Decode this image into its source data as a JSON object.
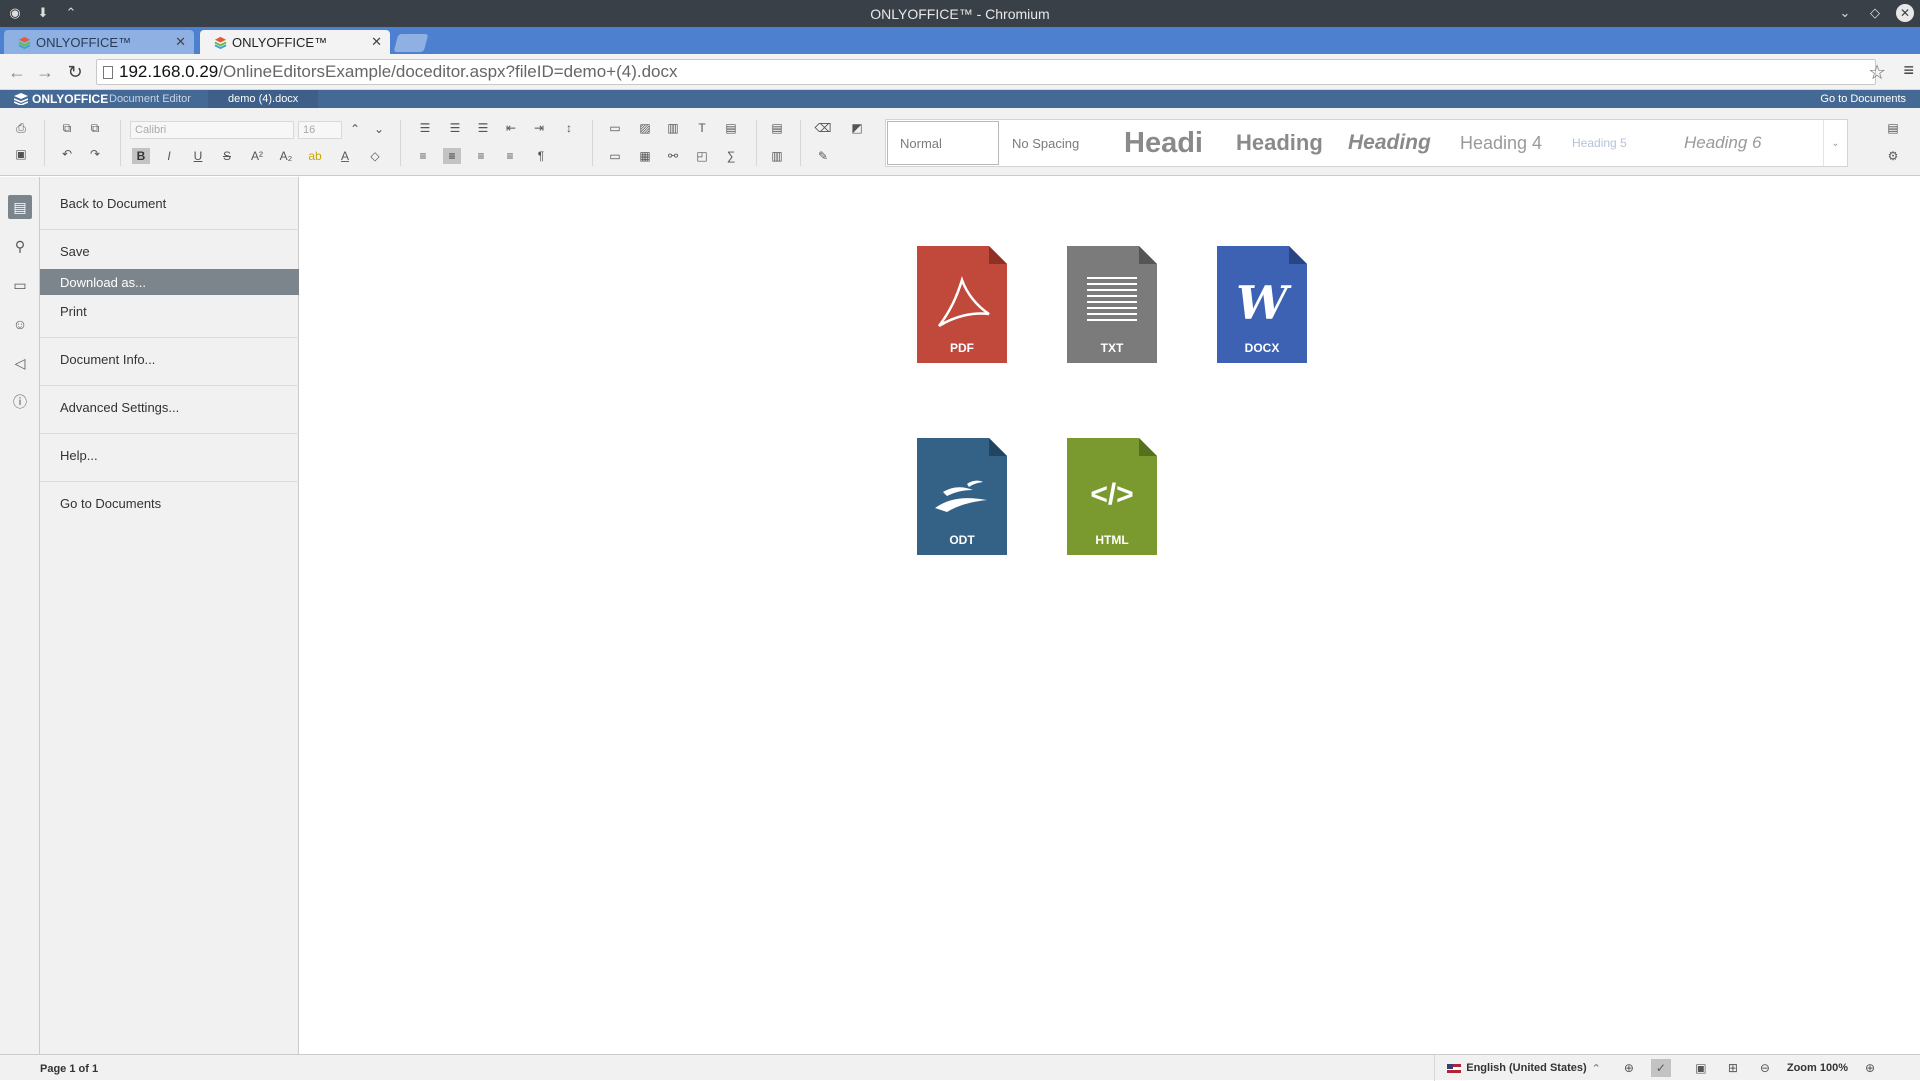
{
  "window": {
    "title": "ONLYOFFICE™ - Chromium"
  },
  "tabs": [
    {
      "label": "ONLYOFFICE™"
    },
    {
      "label": "ONLYOFFICE™"
    }
  ],
  "address": {
    "host": "192.168.0.29",
    "path": "/OnlineEditorsExample/doceditor.aspx?fileID=demo+(4).docx"
  },
  "header": {
    "logo": "ONLYOFFICE",
    "editor": "Document Editor",
    "doc_name": "demo (4).docx",
    "go_to_documents": "Go to Documents"
  },
  "toolbar": {
    "font_name": "Calibri",
    "font_size": "16",
    "styles": [
      "Normal",
      "No Spacing",
      "Headi",
      "Heading",
      "Heading",
      "Heading 4",
      "Heading 5",
      "Heading 6"
    ]
  },
  "file_menu": {
    "items": [
      "Back to Document",
      "Save",
      "Download as...",
      "Print",
      "Document Info...",
      "Advanced Settings...",
      "Help...",
      "Go to Documents"
    ],
    "active_index": 2
  },
  "formats": [
    {
      "label": "PDF",
      "color": "#c0493c"
    },
    {
      "label": "TXT",
      "color": "#7b7b7b"
    },
    {
      "label": "DOCX",
      "color": "#3d62b3"
    },
    {
      "label": "ODT",
      "color": "#346186"
    },
    {
      "label": "HTML",
      "color": "#7a9a30"
    }
  ],
  "docx_glyph": "W",
  "html_glyph": "</>",
  "status": {
    "page": "Page 1 of 1",
    "language": "English (United States)",
    "zoom": "Zoom 100%"
  }
}
